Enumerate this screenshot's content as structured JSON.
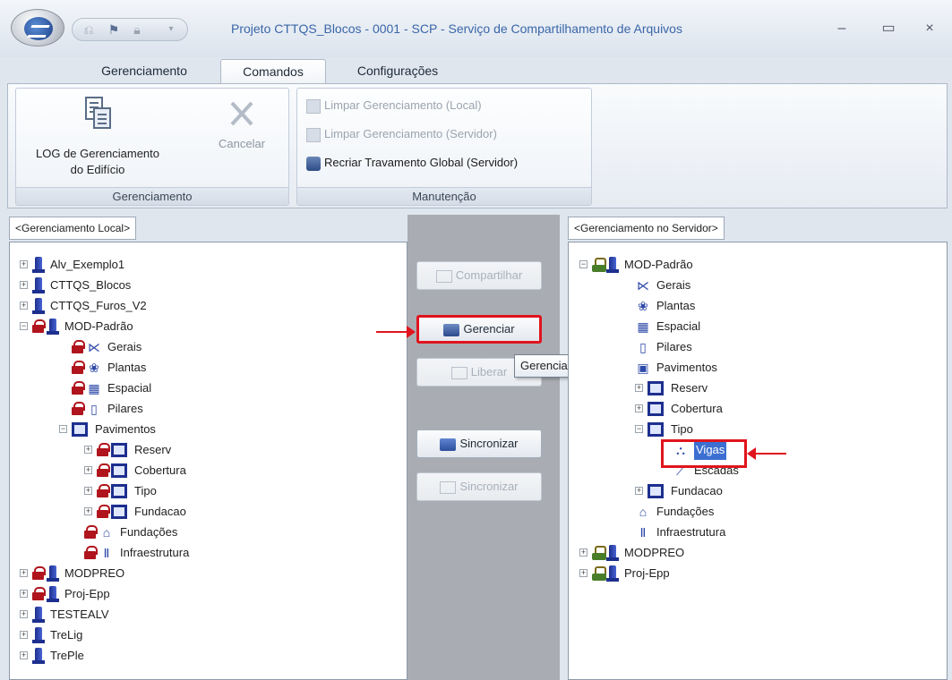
{
  "window": {
    "title": "Projeto CTTQS_Blocos - 0001 - SCP - Serviço de Compartilhamento de Arquivos",
    "minimize": "–",
    "maximize": "▭",
    "close": "×"
  },
  "ribbon": {
    "tabs": [
      "Gerenciamento",
      "Comandos",
      "Configurações"
    ],
    "active_tab": "Comandos",
    "groups": {
      "gerenciamento": {
        "caption": "Gerenciamento",
        "log_button": [
          "LOG de Gerenciamento",
          "do Edifício"
        ],
        "cancel_button": "Cancelar"
      },
      "manutencao": {
        "caption": "Manutenção",
        "items": [
          "Limpar Gerenciamento (Local)",
          "Limpar Gerenciamento (Servidor)",
          "Recriar Travamento Global (Servidor)"
        ]
      }
    }
  },
  "left_panel": {
    "tab": "<Gerenciamento Local>",
    "tree": {
      "alv_exemplo1": "Alv_Exemplo1",
      "cttqs_blocos": "CTTQS_Blocos",
      "cttqs_furos": "CTTQS_Furos_V2",
      "mod_padrao": "MOD-Padrão",
      "gerais": "Gerais",
      "plantas": "Plantas",
      "espacial": "Espacial",
      "pilares": "Pilares",
      "pavimentos": "Pavimentos",
      "reserv": "Reserv",
      "cobertura": "Cobertura",
      "tipo": "Tipo",
      "fundacao": "Fundacao",
      "fundacoes": "Fundações",
      "infraestrutura": "Infraestrutura",
      "modpreo": "MODPREO",
      "proj_epp": "Proj-Epp",
      "testealv": "TESTEALV",
      "trelig": "TreLig",
      "treple": "TrePle"
    }
  },
  "middle": {
    "compartilhar": "Compartilhar",
    "gerenciar": "Gerenciar",
    "liberar": "Liberar",
    "sincronizar_up": "Sincronizar",
    "sincronizar_down": "Sincronizar",
    "tooltip": "Gerenciar Pasta(s)"
  },
  "right_panel": {
    "tab": "<Gerenciamento no Servidor>",
    "tree": {
      "mod_padrao": "MOD-Padrão",
      "gerais": "Gerais",
      "plantas": "Plantas",
      "espacial": "Espacial",
      "pilares": "Pilares",
      "pavimentos": "Pavimentos",
      "reserv": "Reserv",
      "cobertura": "Cobertura",
      "tipo": "Tipo",
      "vigas": "Vigas",
      "escadas": "Escadas",
      "fundacao": "Fundacao",
      "fundacoes": "Fundações",
      "infraestrutura": "Infraestrutura",
      "modpreo": "MODPREO",
      "proj_epp": "Proj-Epp"
    }
  },
  "icons": {
    "lock": "lock-icon",
    "project": "project-icon",
    "shared": "shared-icon",
    "floor": "floor-icon"
  },
  "colors": {
    "highlight": "#e0141e",
    "lock": "#b0141c",
    "selection": "#3c6fd1",
    "title_text": "#3a66a8"
  }
}
